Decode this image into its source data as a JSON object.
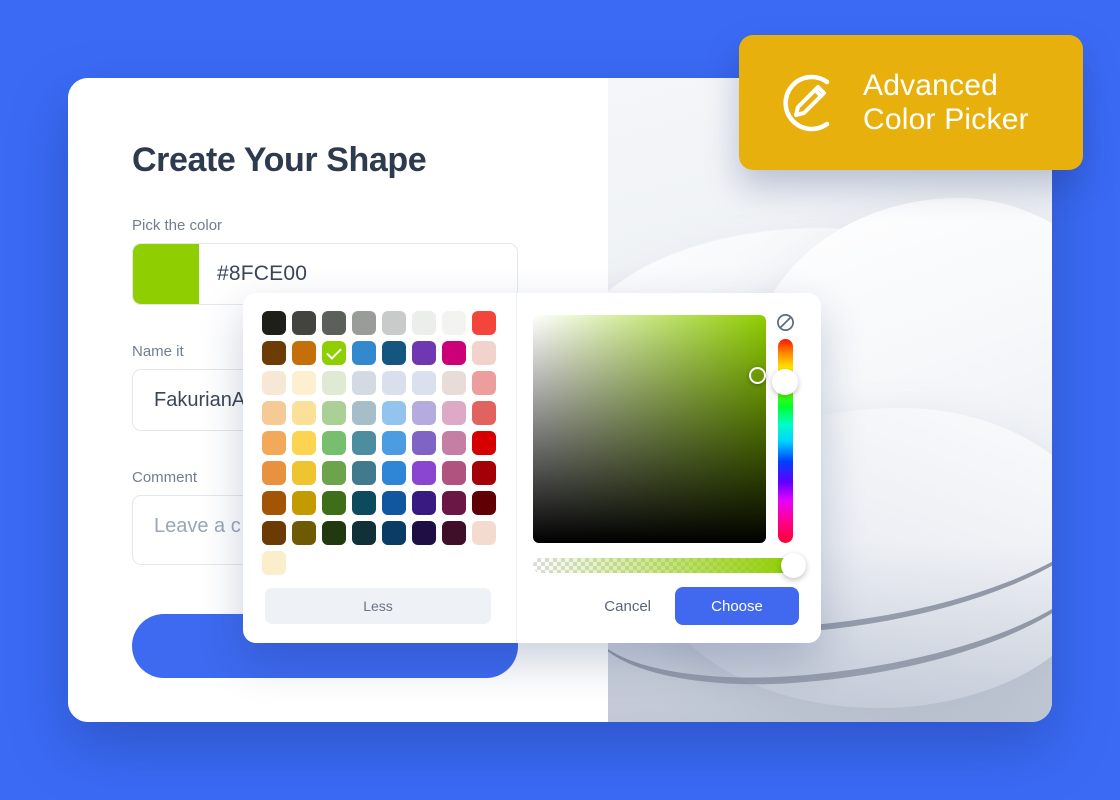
{
  "background_color": "#3b6bf5",
  "brand_badge": {
    "text": "Advanced\nColor Picker",
    "background_color": "#e8b00d",
    "icon": "eyedropper-circle-icon"
  },
  "form": {
    "title": "Create Your Shape",
    "fields": {
      "color": {
        "label": "Pick the color",
        "value": "#8FCE00",
        "swatch_color": "#8FCE00"
      },
      "name": {
        "label": "Name it",
        "value": "FakurianA"
      },
      "comment": {
        "label": "Comment",
        "placeholder": "Leave a c"
      }
    },
    "submit_label": ""
  },
  "color_picker": {
    "selected_color": "#8FCE00",
    "less_label": "Less",
    "cancel_label": "Cancel",
    "choose_label": "Choose",
    "no_color_icon": "no-color-icon",
    "accent_color": "#4169f0",
    "swatches": [
      {
        "color": "#1f1f1a",
        "selected": false
      },
      {
        "color": "#43443f",
        "selected": false
      },
      {
        "color": "#5b605a",
        "selected": false
      },
      {
        "color": "#9a9c9a",
        "selected": false
      },
      {
        "color": "#c9cbca",
        "selected": false
      },
      {
        "color": "#eceeec",
        "selected": false
      },
      {
        "color": "#f3f4f2",
        "selected": false
      },
      {
        "color": "#f4453a",
        "selected": false
      },
      {
        "color": "#6d3c06",
        "selected": false
      },
      {
        "color": "#c4700a",
        "selected": false
      },
      {
        "color": "#8FCE00",
        "selected": true
      },
      {
        "color": "#3389ce",
        "selected": false
      },
      {
        "color": "#14567f",
        "selected": false
      },
      {
        "color": "#7038b0",
        "selected": false
      },
      {
        "color": "#cc0077",
        "selected": false
      },
      {
        "color": "#f2d3cb",
        "selected": false
      },
      {
        "color": "#f6e8d5",
        "selected": false
      },
      {
        "color": "#fdefcf",
        "selected": false
      },
      {
        "color": "#dfe9d4",
        "selected": false
      },
      {
        "color": "#d4dae4",
        "selected": false
      },
      {
        "color": "#dadfee",
        "selected": false
      },
      {
        "color": "#dbe0ef",
        "selected": false
      },
      {
        "color": "#e8dcd9",
        "selected": false
      },
      {
        "color": "#eb9e9c",
        "selected": false
      },
      {
        "color": "#f6ca94",
        "selected": false
      },
      {
        "color": "#fbe09a",
        "selected": false
      },
      {
        "color": "#abd096",
        "selected": false
      },
      {
        "color": "#a5bec9",
        "selected": false
      },
      {
        "color": "#93c4ef",
        "selected": false
      },
      {
        "color": "#b5abdf",
        "selected": false
      },
      {
        "color": "#dcaac6",
        "selected": false
      },
      {
        "color": "#e2625f",
        "selected": false
      },
      {
        "color": "#f2a95a",
        "selected": false
      },
      {
        "color": "#fcd452",
        "selected": false
      },
      {
        "color": "#77be6f",
        "selected": false
      },
      {
        "color": "#4d8da0",
        "selected": false
      },
      {
        "color": "#4b9ce0",
        "selected": false
      },
      {
        "color": "#8064c5",
        "selected": false
      },
      {
        "color": "#c57fa5",
        "selected": false
      },
      {
        "color": "#d60000",
        "selected": false
      },
      {
        "color": "#e8913f",
        "selected": false
      },
      {
        "color": "#eec431",
        "selected": false
      },
      {
        "color": "#6ba44b",
        "selected": false
      },
      {
        "color": "#41798d",
        "selected": false
      },
      {
        "color": "#2f86d6",
        "selected": false
      },
      {
        "color": "#8a45d1",
        "selected": false
      },
      {
        "color": "#b0537f",
        "selected": false
      },
      {
        "color": "#a40008",
        "selected": false
      },
      {
        "color": "#a35506",
        "selected": false
      },
      {
        "color": "#c49a02",
        "selected": false
      },
      {
        "color": "#3e6e1a",
        "selected": false
      },
      {
        "color": "#0d4a5e",
        "selected": false
      },
      {
        "color": "#10579f",
        "selected": false
      },
      {
        "color": "#381a81",
        "selected": false
      },
      {
        "color": "#6b1745",
        "selected": false
      },
      {
        "color": "#600005",
        "selected": false
      },
      {
        "color": "#6b3a05",
        "selected": false
      },
      {
        "color": "#6e5a04",
        "selected": false
      },
      {
        "color": "#22390f",
        "selected": false
      },
      {
        "color": "#123038",
        "selected": false
      },
      {
        "color": "#0a3c66",
        "selected": false
      },
      {
        "color": "#1d0e43",
        "selected": false
      },
      {
        "color": "#3f0e29",
        "selected": false
      },
      {
        "color": "#f3dccf",
        "selected": false
      },
      {
        "color": "#faeecb",
        "selected": false
      }
    ]
  }
}
